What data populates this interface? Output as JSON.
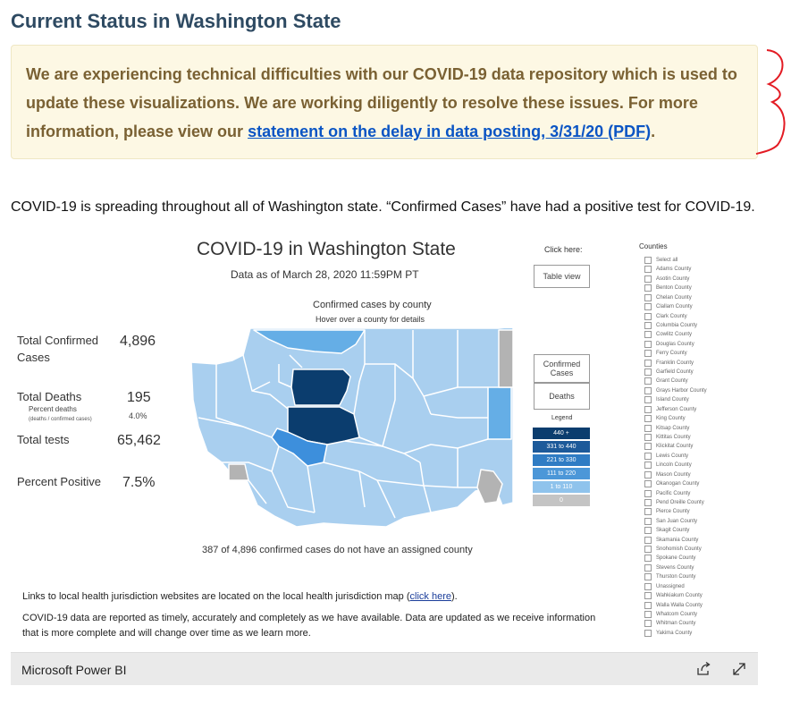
{
  "page": {
    "title": "Current Status in Washington State",
    "alert": {
      "text": "We are experiencing technical difficulties with our COVID-19 data repository which is used to update these visualizations. We are working diligently to resolve these issues. For more information, please view our ",
      "link_text": "statement on the delay in data posting, 3/31/20 (PDF)",
      "suffix": "."
    },
    "intro": "COVID-19 is spreading throughout all of Washington state. “Confirmed Cases” have had a positive test for COVID-19."
  },
  "dashboard": {
    "title": "COVID-19 in Washington State",
    "date": "Data as of March 28, 2020 11:59PM PT",
    "click_here": "Click here:",
    "table_view": "Table view",
    "btn_confirmed": "Confirmed Cases",
    "btn_deaths": "Deaths",
    "map_subtitle": "Confirmed cases by county",
    "map_hint": "Hover over a county for details",
    "stats": {
      "confirmed_label": "Total Confirmed Cases",
      "confirmed_value": "4,896",
      "deaths_label": "Total Deaths",
      "deaths_value": "195",
      "percent_deaths_label": "Percent deaths",
      "percent_deaths_sub": "(deaths / confirmed cases)",
      "percent_deaths_value": "4.0%",
      "tests_label": "Total tests",
      "tests_value": "65,462",
      "positive_label": "Percent Positive",
      "positive_value": "7.5%"
    },
    "unassigned_note": "387 of 4,896 confirmed cases do not have an assigned county",
    "legend_title": "Legend",
    "legend": [
      {
        "label": "440 +",
        "color": "#0b3d6e"
      },
      {
        "label": "331 to 440",
        "color": "#1d5a9a"
      },
      {
        "label": "221 to 330",
        "color": "#2f7cc4"
      },
      {
        "label": "111 to 220",
        "color": "#4c97d8"
      },
      {
        "label": "1 to 110",
        "color": "#8fc3ec"
      },
      {
        "label": "0",
        "color": "#c4c4c4"
      }
    ],
    "counties_title": "Counties",
    "counties": [
      "Select all",
      "Adams County",
      "Asotin County",
      "Benton County",
      "Chelan County",
      "Clallam County",
      "Clark County",
      "Columbia County",
      "Cowlitz County",
      "Douglas County",
      "Ferry County",
      "Franklin County",
      "Garfield County",
      "Grant County",
      "Grays Harbor County",
      "Island County",
      "Jefferson County",
      "King County",
      "Kitsap County",
      "Kittitas County",
      "Klickitat County",
      "Lewis County",
      "Lincoln County",
      "Mason County",
      "Okanogan County",
      "Pacific County",
      "Pend Oreille County",
      "Pierce County",
      "San Juan County",
      "Skagit County",
      "Skamania County",
      "Snohomish County",
      "Spokane County",
      "Stevens County",
      "Thurston County",
      "Unassigned",
      "Wahkiakum County",
      "Walla Walla County",
      "Whatcom County",
      "Whitman County",
      "Yakima County"
    ],
    "links_text": "Links to local health jurisdiction websites are located on the local health jurisdiction map (",
    "links_link": "click here",
    "links_suffix": ").",
    "disclaimer": "COVID-19 data are reported as timely, accurately and completely as we have available. Data are updated as we receive information that is more complete and will change over time as we learn more."
  },
  "footer": {
    "brand": "Microsoft Power BI"
  },
  "colors": {
    "title": "#2e4a62",
    "alert_bg": "#fdf8e4",
    "alert_text": "#7a6133",
    "county_light": "#a9cfef",
    "county_mid": "#65aee6",
    "county_pierce": "#3d8fdc",
    "county_dark": "#0b3d6e",
    "county_zero": "#b3b3b3",
    "annotation_red": "#e31b23"
  }
}
